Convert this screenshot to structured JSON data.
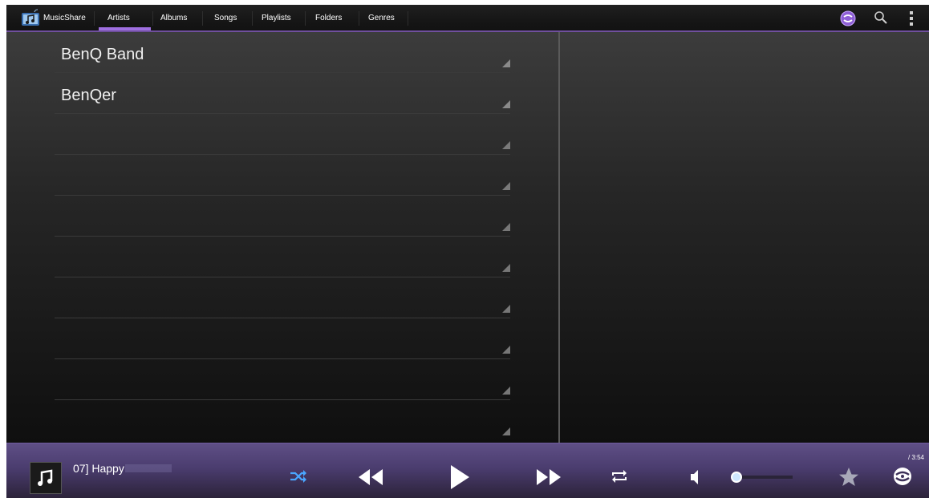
{
  "app": {
    "name": "MusicShare"
  },
  "tabs": [
    {
      "label": "Artists",
      "selected": true
    },
    {
      "label": "Albums"
    },
    {
      "label": "Songs"
    },
    {
      "label": "Playlists"
    },
    {
      "label": "Folders"
    },
    {
      "label": "Genres"
    }
  ],
  "topbar_icons": [
    "share-icon",
    "search-icon",
    "overflow-menu-icon"
  ],
  "artists": [
    {
      "label": "BenQ Band"
    },
    {
      "label": "BenQer"
    },
    {
      "label": ""
    },
    {
      "label": ""
    },
    {
      "label": ""
    },
    {
      "label": ""
    },
    {
      "label": ""
    },
    {
      "label": ""
    },
    {
      "label": ""
    },
    {
      "label": ""
    }
  ],
  "player": {
    "now_playing": "07] Happy",
    "duration": "/ 3:54",
    "volume_level": 0.08,
    "controls": [
      "shuffle-icon",
      "rewind-icon",
      "play-icon",
      "fast-forward-icon",
      "repeat-icon",
      "volume-icon",
      "favorite-star-icon",
      "dlna-share-icon"
    ]
  },
  "colors": {
    "accent": "#7b56b8",
    "shuffle_active": "#4aa6ff"
  }
}
